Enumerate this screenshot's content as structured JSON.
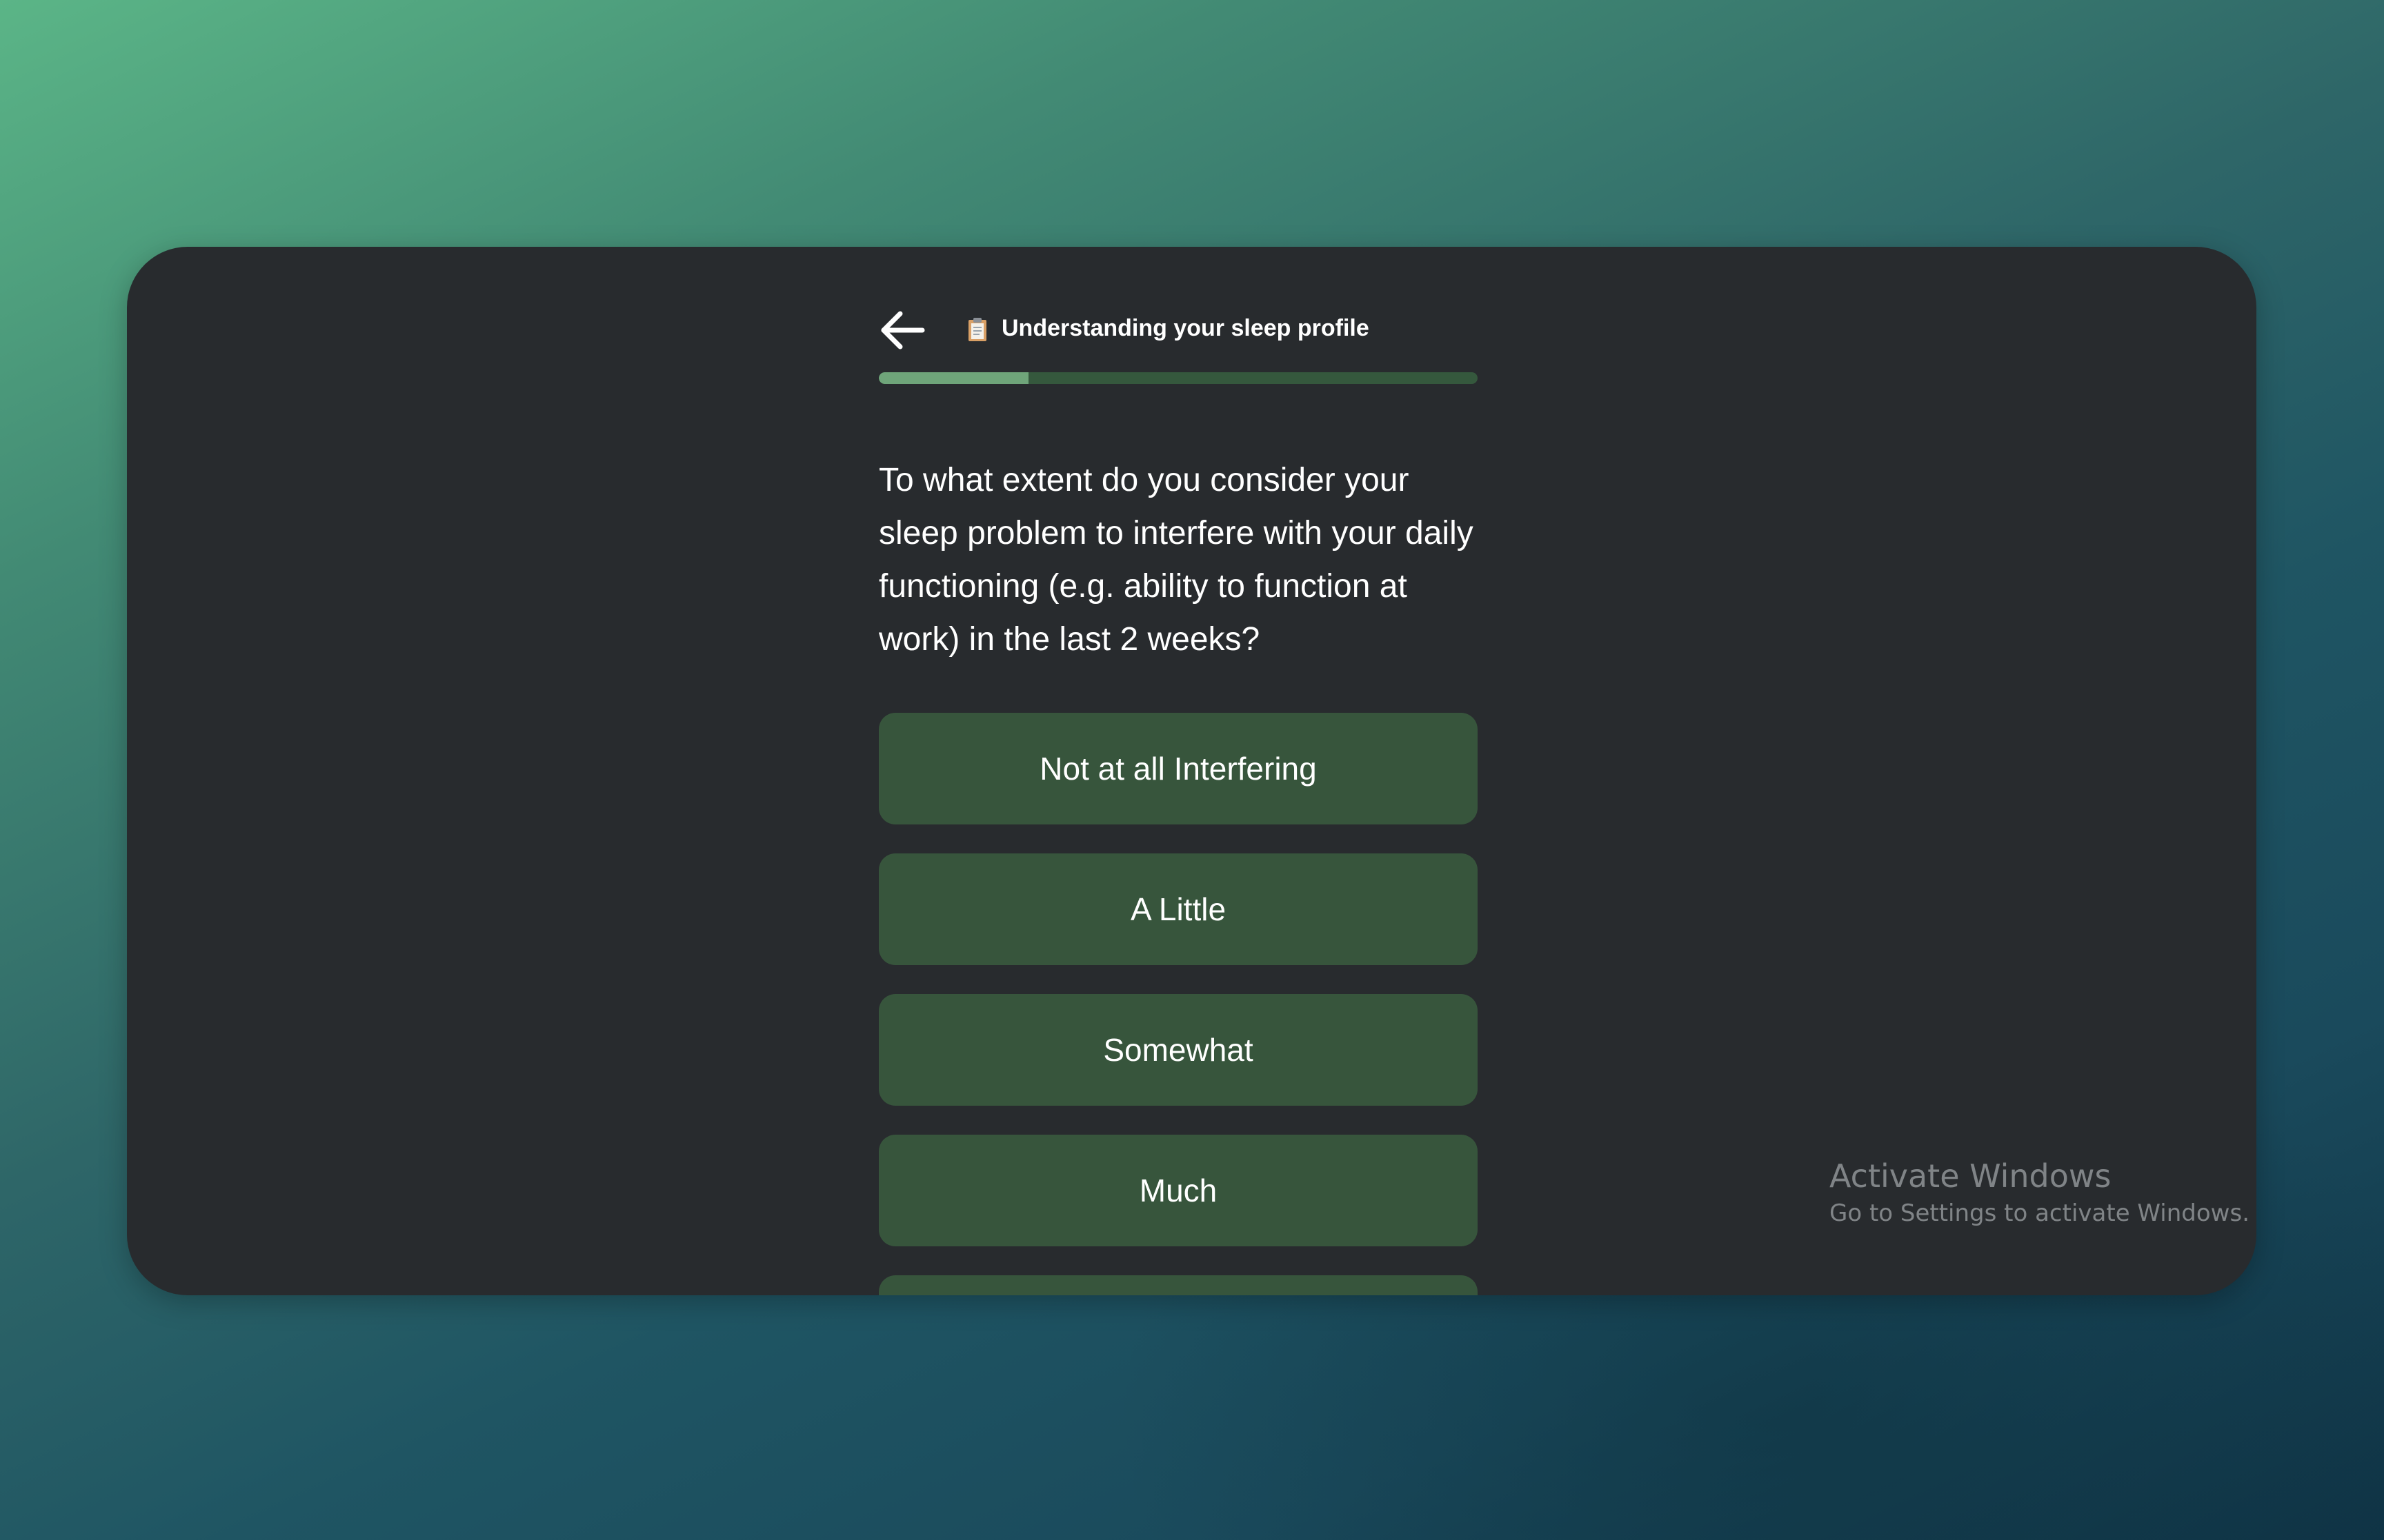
{
  "header": {
    "back_icon": "arrow-left-icon",
    "title_icon": "clipboard-icon",
    "title": "Understanding your sleep profile"
  },
  "progress": {
    "fraction": 0.25,
    "fill_color": "#6fa57a",
    "track_color": "#35583d"
  },
  "question": {
    "text": "To what extent do you consider your sleep problem to interfere with your daily functioning (e.g. ability to function at work) in the last 2 weeks?"
  },
  "options": [
    {
      "label": "Not at all Interfering"
    },
    {
      "label": "A Little"
    },
    {
      "label": "Somewhat"
    },
    {
      "label": "Much"
    },
    {
      "label": ""
    }
  ],
  "colors": {
    "panel": "#282b2e",
    "option_button": "#37553c"
  },
  "watermark": {
    "title": "Activate Windows",
    "subtitle": "Go to Settings to activate Windows."
  }
}
